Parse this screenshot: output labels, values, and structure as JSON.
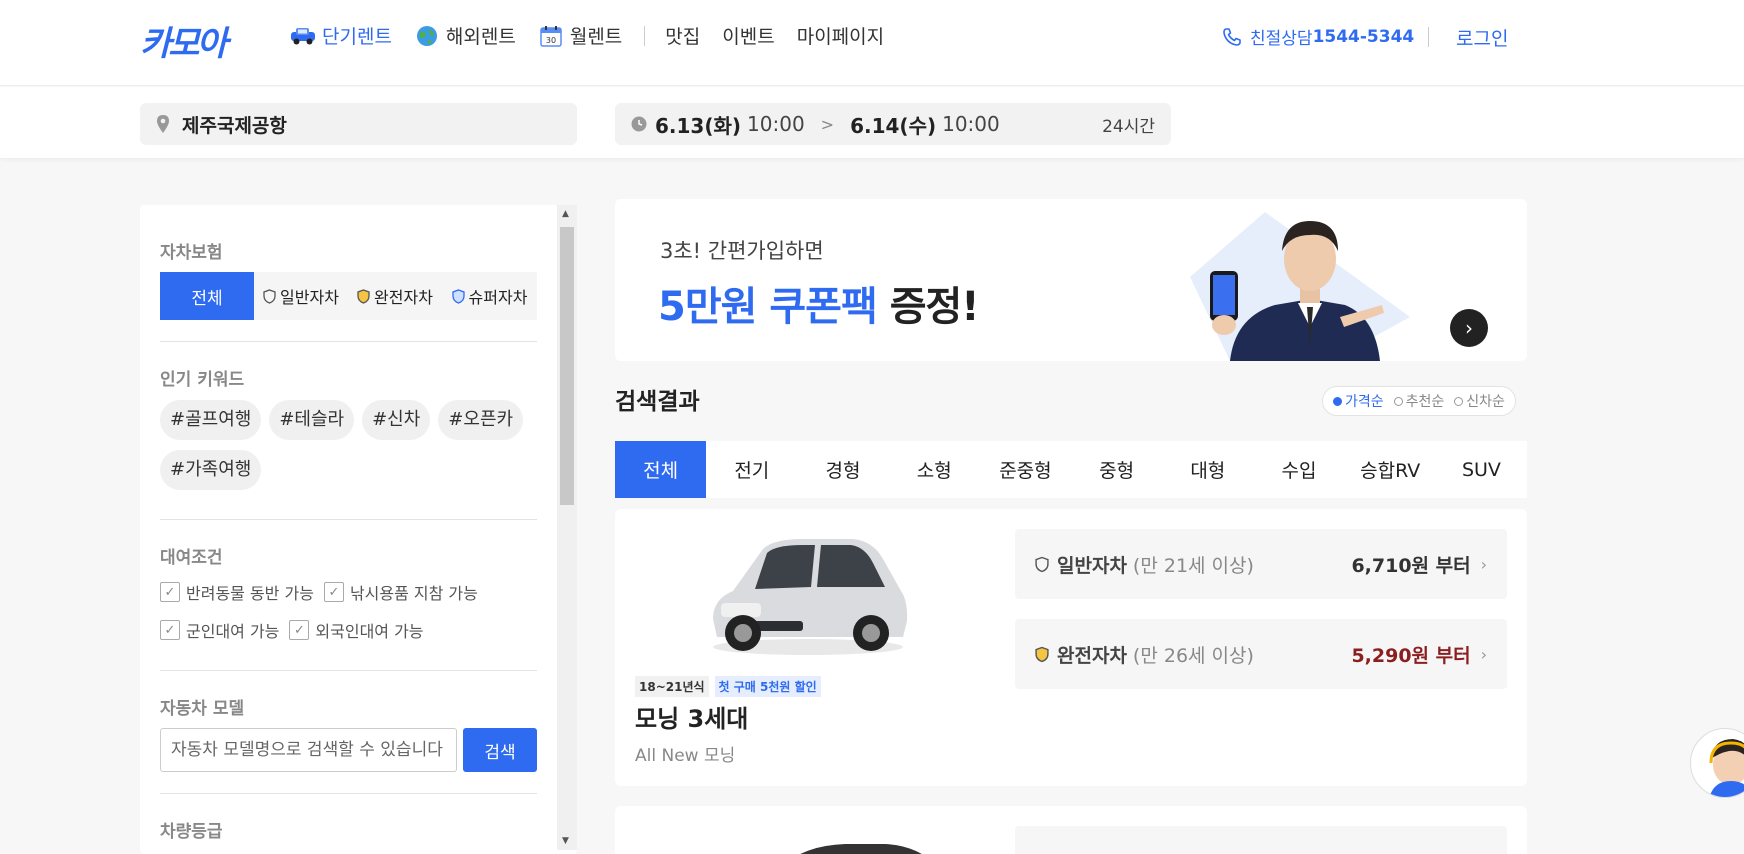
{
  "header": {
    "logo": "카모아",
    "nav": [
      {
        "label": "단기렌트",
        "icon": "car-icon",
        "active": true
      },
      {
        "label": "해외렌트",
        "icon": "globe-icon",
        "active": false
      },
      {
        "label": "월렌트",
        "icon": "calendar-icon",
        "active": false
      },
      {
        "label": "맛집",
        "active": false
      },
      {
        "label": "이벤트",
        "active": false
      },
      {
        "label": "마이페이지",
        "active": false
      }
    ],
    "calendar_day": "30",
    "phone_prefix": "친절상담",
    "phone_number": "1544-5344",
    "login": "로그인"
  },
  "search": {
    "location": "제주국제공항",
    "start_date": "6.13(화)",
    "start_time": "10:00",
    "end_date": "6.14(수)",
    "end_time": "10:00",
    "duration": "24시간"
  },
  "sidebar": {
    "insurance_title": "자차보험",
    "insurance_tabs": [
      "전체",
      "일반자차",
      "완전자차",
      "슈퍼자차"
    ],
    "keywords_title": "인기 키워드",
    "keywords": [
      "#골프여행",
      "#테슬라",
      "#신차",
      "#오픈카",
      "#가족여행"
    ],
    "conditions_title": "대여조건",
    "conditions": [
      "반려동물 동반 가능",
      "낚시용품 지참 가능",
      "군인대여 가능",
      "외국인대여 가능"
    ],
    "model_title": "자동차 모델",
    "model_placeholder": "자동차 모델명으로 검색할 수 있습니다",
    "model_button": "검색",
    "grade_title": "차량등급"
  },
  "banner": {
    "subtitle": "3초! 간편가입하면",
    "highlight": "5만원 쿠폰팩",
    "title_rest": "증정!"
  },
  "results": {
    "title": "검색결과",
    "sort": [
      "가격순",
      "추천순",
      "신차순"
    ],
    "categories": [
      "전체",
      "전기",
      "경형",
      "소형",
      "준중형",
      "중형",
      "대형",
      "수입",
      "승합RV",
      "SUV"
    ]
  },
  "car": {
    "year_badge": "18~21년식",
    "discount_badge": "첫 구매 5천원 할인",
    "name": "모닝 3세대",
    "subname": "All New 모닝",
    "prices": [
      {
        "type": "일반자차",
        "age": "(만 21세 이상)",
        "price": "6,710원 부터"
      },
      {
        "type": "완전자차",
        "age": "(만 26세 이상)",
        "price": "5,290원 부터"
      }
    ]
  },
  "colors": {
    "accent": "#2f6bf0",
    "price_red": "#8b1f1f"
  }
}
